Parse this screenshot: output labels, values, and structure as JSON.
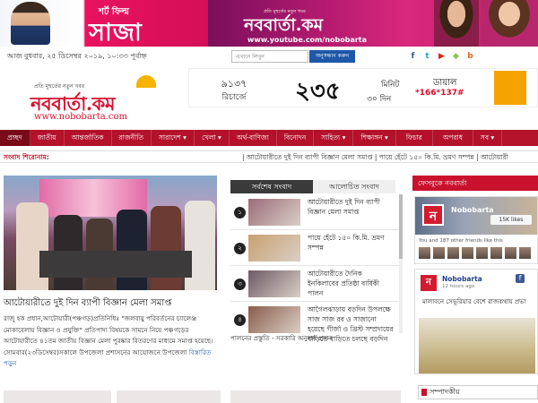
{
  "top_banner": {
    "left_small": "শর্ট ফিল্ম",
    "left_big": "সাজা",
    "right_tagline": "প্রতি মূহুর্তের নতুন খবর",
    "right_logo": "নববার্তা.কম",
    "right_url": "www.youtube.com/nobobarta"
  },
  "header": {
    "date": "আজ বুধবার, ২৫ ডিসেম্বর ২০১৯, ১০:৩৩ পূর্বাহ্ন",
    "search": {
      "placeholder": "এখানে লিখুন",
      "button_label": "অনুসন্ধান করুন"
    },
    "social_icons": [
      {
        "name": "facebook-icon",
        "glyph": "f",
        "color": "#3b5998"
      },
      {
        "name": "twitter-icon",
        "glyph": "t",
        "color": "#1da1f2"
      },
      {
        "name": "youtube-icon",
        "glyph": "▶",
        "color": "#e62117"
      },
      {
        "name": "android-icon",
        "glyph": "◆",
        "color": "#8bc34a"
      },
      {
        "name": "blog-icon",
        "glyph": "b",
        "color": "#e8651c"
      }
    ]
  },
  "logo": {
    "tagline": "প্রতি মূহুর্তের নতুন খবর",
    "name": "নববার্তা.কম",
    "url": "www.nobobarta.com"
  },
  "ad": {
    "price1": "৯১৩৭",
    "price1_sub": "রিচার্জে",
    "minutes": "২৩৫",
    "minutes_unit": "মিনিট",
    "days": "৩০ দিন",
    "dial": "ডায়াল",
    "code": "*166*137#"
  },
  "nav": {
    "items": [
      {
        "label": "প্রচ্ছদ",
        "active": true
      },
      {
        "label": "জাতীয়"
      },
      {
        "label": "আন্তর্জাতিক"
      },
      {
        "label": "রাজনীতি"
      },
      {
        "label": "সারাদেশ ▾"
      },
      {
        "label": "খেলা ▾"
      },
      {
        "label": "অর্থ-বাণিজ্য"
      },
      {
        "label": "বিনোদন"
      },
      {
        "label": "সাহিত্য ▾"
      },
      {
        "label": "শিক্ষাঙ্গন ▾"
      },
      {
        "label": "ফিচার"
      },
      {
        "label": "অপরাধ"
      },
      {
        "label": "সব ▾"
      }
    ]
  },
  "ticker": {
    "label": "সংবাদ শিরোনাম:",
    "text": "| আটোয়ারীতে দুই দিন ব্যাপী বিজ্ঞান মেলা সমাপ্ত  | পায়ে হেঁটে ১৫০ কি.মি. ভ্রমণ সম্পন্ন | আটোয়ারী"
  },
  "lead": {
    "title": "আটোয়ারীতে দুই দিন ব্যাপী বিজ্ঞান মেলা সমাপ্ত",
    "body": "রাজু হক প্রধান,আটোয়ারী(পঞ্চগড়)প্রতিনিধিঃ \"জলবায়ু পরিবর্তনের চ্যালেঞ্জ মোকাবেলায় বিজ্ঞান ও প্রযুক্তি\" প্রতিপাদ্য বিষয়কে সামনে নিয়ে পঞ্চগড়ের আটোয়ারীতে ৪১তম জাতীয় বিজ্ঞান মেলা পুরষ্কার বিতরণের মাধ্যমে সমাপ্ত হয়েছে। সোমবার(২৩ডিসেম্বর)সকালে উপজেলা প্রশাসনের আয়োজনে উপজেলা",
    "more": "বিস্তারিত পড়ুন"
  },
  "tabs": [
    {
      "label": "সর্বশেষ সংবাদ",
      "active": true
    },
    {
      "label": "আলোচিত সংবাদ",
      "active": false
    }
  ],
  "latest_news": [
    {
      "num": "১",
      "title": "আটোয়ারীতে দুই দিন ব্যাপী বিজ্ঞান মেলা সমাপ্ত",
      "thumb": "#9b6b7a"
    },
    {
      "num": "২",
      "title": "পায়ে হেঁটে ১৫০ কি.মি. ভ্রমণ সম্পন্ন",
      "thumb": "#c9a070"
    },
    {
      "num": "৩",
      "title": "আটোয়ারীতে দৈনিক ইনকিলাবের প্রতিষ্ঠা বার্ষিকী পালন",
      "thumb": "#6d5a66"
    },
    {
      "num": "৪",
      "title": "আগৈলঝাড়ায় বড়দিন উপলক্ষে সাজ সাজ রব ও সাজানো হয়েছে গীর্জা ও খ্রিস্ট সম্প্রদায়ের বাড়িতে বাড়িতে চলছে বড়দিন",
      "thumb": "#8a5c4a"
    }
  ],
  "mid_foot": "পালনের প্রস্তুতি - সরকারি অনুদান প্রদান",
  "facebook": {
    "section_title": "ফেসবুকে নববার্তা",
    "page_name": "Nobobarta",
    "like_label": "15K likes",
    "friends_text": "You and 187 other friends like this",
    "post_name": "Nobobarta",
    "post_time": "12 hours ago",
    "post_text": "মালাবনে সেভূরিয়ার বেশে রাজকথায় প্রভা"
  },
  "editorial_label": "সম্পাদকীয়"
}
